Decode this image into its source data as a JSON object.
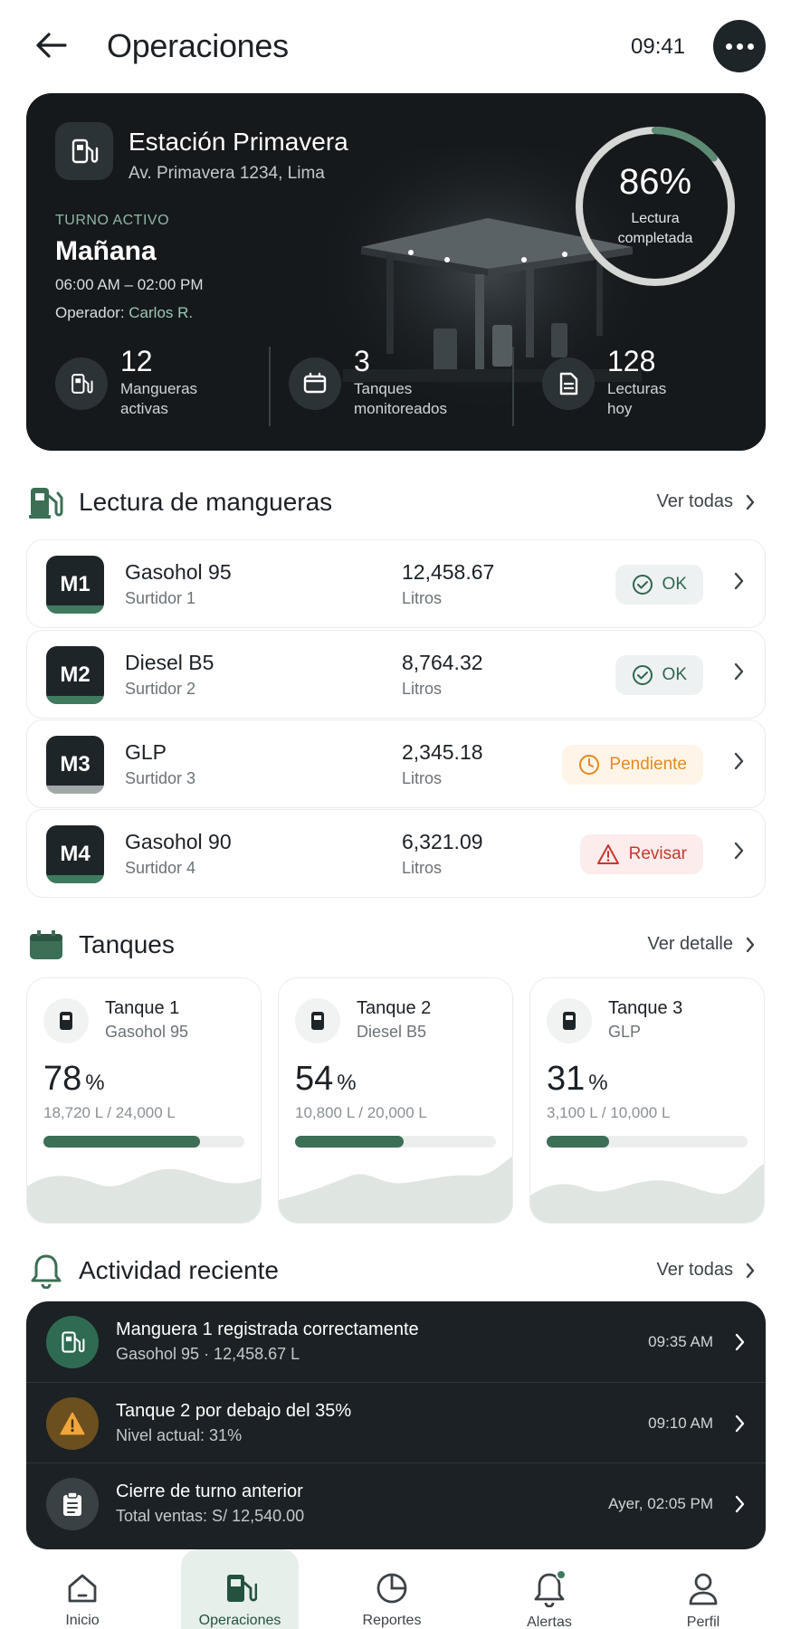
{
  "header": {
    "title": "Operaciones",
    "time": "09:41"
  },
  "station": {
    "name": "Estación Primavera",
    "address": "Av. Primavera 1234, Lima",
    "shift_caption": "TURNO ACTIVO",
    "shift_name": "Mañana",
    "shift_time": "06:00 AM – 02:00 PM",
    "operator_label": "Operador:",
    "operator_name": "Carlos R.",
    "completion": {
      "value": "86%",
      "fraction": 0.86,
      "caption_line1": "Lectura",
      "caption_line2": "completada"
    },
    "stats": [
      {
        "value": "12",
        "line1": "Mangueras",
        "line2": "activas",
        "icon": "fuel-pump-icon"
      },
      {
        "value": "3",
        "line1": "Tanques",
        "line2": "monitoreados",
        "icon": "tank-icon"
      },
      {
        "value": "128",
        "line1": "Lecturas",
        "line2": "hoy",
        "icon": "document-icon"
      }
    ]
  },
  "hoses_section": {
    "title": "Lectura de mangueras",
    "link": "Ver todas",
    "items": [
      {
        "code": "M1",
        "fuel": "Gasohol 95",
        "pump": "Surtidor 1",
        "reading": "12,458.67",
        "unit": "Litros",
        "status": "OK",
        "status_type": "ok"
      },
      {
        "code": "M2",
        "fuel": "Diesel B5",
        "pump": "Surtidor 2",
        "reading": "8,764.32",
        "unit": "Litros",
        "status": "OK",
        "status_type": "ok"
      },
      {
        "code": "M3",
        "fuel": "GLP",
        "pump": "Surtidor 3",
        "reading": "2,345.18",
        "unit": "Litros",
        "status": "Pendiente",
        "status_type": "pending"
      },
      {
        "code": "M4",
        "fuel": "Gasohol 90",
        "pump": "Surtidor 4",
        "reading": "6,321.09",
        "unit": "Litros",
        "status": "Revisar",
        "status_type": "review"
      }
    ]
  },
  "tanks_section": {
    "title": "Tanques",
    "link": "Ver detalle",
    "items": [
      {
        "name": "Tanque 1",
        "fuel": "Gasohol 95",
        "percent": "78",
        "percent_sign": "%",
        "volume": "18,720 L / 24,000 L",
        "level": 0.78
      },
      {
        "name": "Tanque 2",
        "fuel": "Diesel B5",
        "percent": "54",
        "percent_sign": "%",
        "volume": "10,800 L / 20,000 L",
        "level": 0.54
      },
      {
        "name": "Tanque 3",
        "fuel": "GLP",
        "percent": "31",
        "percent_sign": "%",
        "volume": "3,100 L / 10,000 L",
        "level": 0.31
      }
    ]
  },
  "activity_section": {
    "title": "Actividad reciente",
    "link": "Ver todas",
    "items": [
      {
        "title": "Manguera 1 registrada correctamente",
        "subtitle": "Gasohol 95 · 12,458.67 L",
        "time": "09:35 AM",
        "icon": "fuel-pump-icon",
        "color": "#2f6b52"
      },
      {
        "title": "Tanque 2 por debajo del 35%",
        "subtitle": "Nivel actual: 31%",
        "time": "09:10 AM",
        "icon": "warning-icon",
        "color": "#6b4f1e"
      },
      {
        "title": "Cierre de turno anterior",
        "subtitle": "Total ventas: S/ 12,540.00",
        "time": "Ayer, 02:05 PM",
        "icon": "clipboard-icon",
        "color": "#3a4144"
      }
    ]
  },
  "bottom_nav": {
    "items": [
      {
        "label": "Inicio",
        "icon": "home-icon"
      },
      {
        "label": "Operaciones",
        "icon": "fuel-pump-icon",
        "active": true
      },
      {
        "label": "Reportes",
        "icon": "pie-chart-icon"
      },
      {
        "label": "Alertas",
        "icon": "bell-icon",
        "badge": true
      },
      {
        "label": "Perfil",
        "icon": "user-icon"
      }
    ]
  },
  "colors": {
    "accent": "#3c6f55",
    "dark": "#15191c",
    "ok": "#2f6650",
    "pending": "#e58a1d",
    "review": "#c7382f"
  }
}
